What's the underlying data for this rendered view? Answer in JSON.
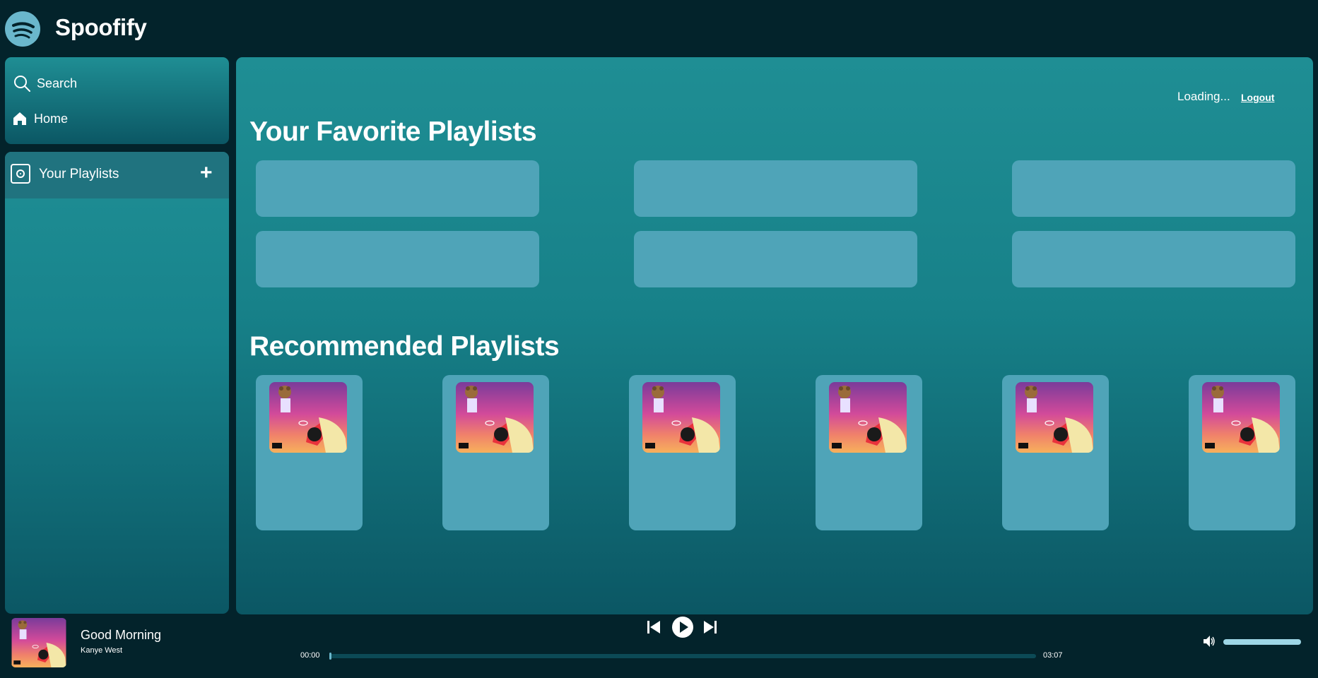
{
  "app": {
    "title": "Spoofify"
  },
  "sidebar": {
    "search_label": "Search",
    "home_label": "Home",
    "library_title": "Your Playlists",
    "add_label": "+"
  },
  "header": {
    "user_status": "Loading...",
    "logout_label": "Logout"
  },
  "main": {
    "favorites_title": "Your Favorite Playlists",
    "favorite_count": 6,
    "recommended_title": "Recommended Playlists",
    "recommended_count": 6
  },
  "player": {
    "track_title": "Good Morning",
    "artist": "Kanye West",
    "elapsed": "00:00",
    "duration": "03:07",
    "progress": 0.003,
    "volume": 1.0
  },
  "icons": [
    "spoofify-logo-icon",
    "search-icon",
    "home-icon",
    "library-icon",
    "plus-icon",
    "prev-icon",
    "play-icon",
    "next-icon",
    "volume-icon"
  ],
  "colors": {
    "background": "#03232b",
    "panel_top": "#1f8e94",
    "panel_bottom": "#0b5764",
    "card": "#4fa4b8",
    "accent": "#6ab7cc"
  }
}
